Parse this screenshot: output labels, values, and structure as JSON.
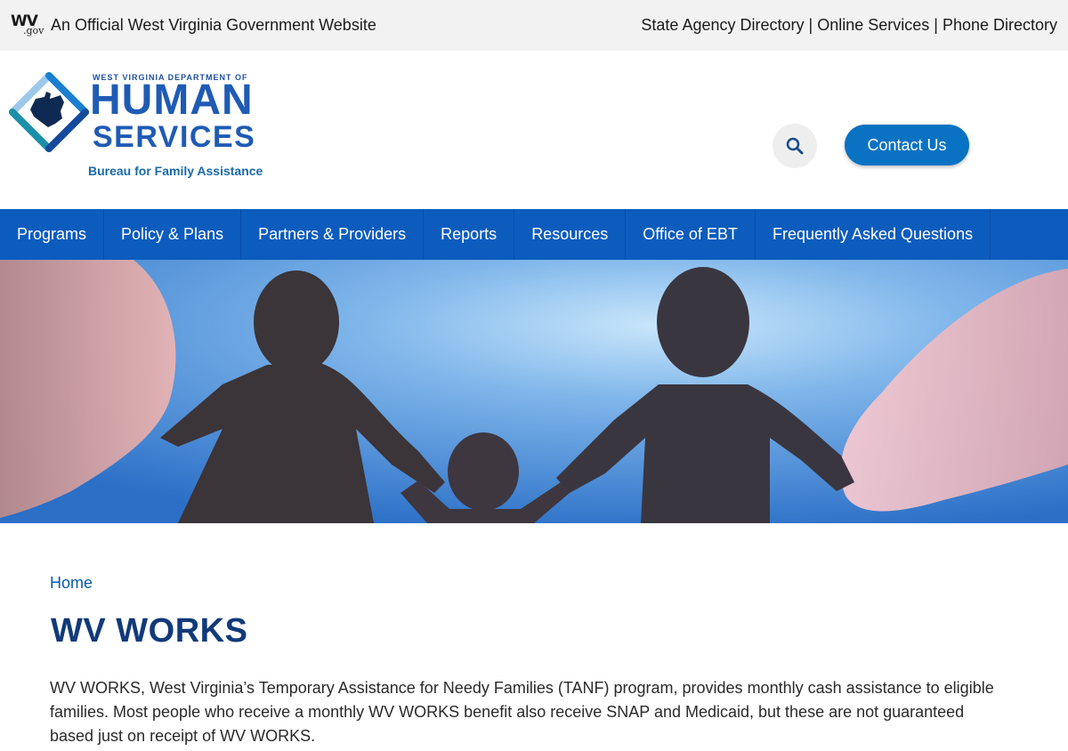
{
  "topbar": {
    "wv_logo_text": "WV",
    "wv_logo_sub": ".gov",
    "official_text": "An Official West Virginia Government Website",
    "links": [
      "State Agency Directory",
      "Online Services",
      "Phone Directory"
    ],
    "separator": "|"
  },
  "logo": {
    "dept_line": "WEST VIRGINIA DEPARTMENT OF",
    "human": "HUMAN",
    "services": "SERVICES",
    "bureau": "Bureau for Family Assistance"
  },
  "header": {
    "search_icon": "search-icon",
    "contact_label": "Contact Us"
  },
  "nav": {
    "items": [
      "Programs",
      "Policy & Plans",
      "Partners & Providers",
      "Reports",
      "Resources",
      "Office of EBT",
      "Frequently Asked Questions"
    ]
  },
  "breadcrumb": {
    "home": "Home"
  },
  "page": {
    "title": "WV WORKS",
    "intro": "WV WORKS, West Virginia’s Temporary Assistance for Needy Families (TANF) program, provides monthly cash assistance to eligible families. Most people who receive a monthly WV WORKS benefit also receive SNAP and Medicaid, but these are not guaranteed based just on receipt of WV WORKS."
  },
  "colors": {
    "nav_bg": "#0c5cbe",
    "contact_bg": "#0a72c2",
    "title": "#113a7a",
    "link": "#0a5aa8"
  }
}
